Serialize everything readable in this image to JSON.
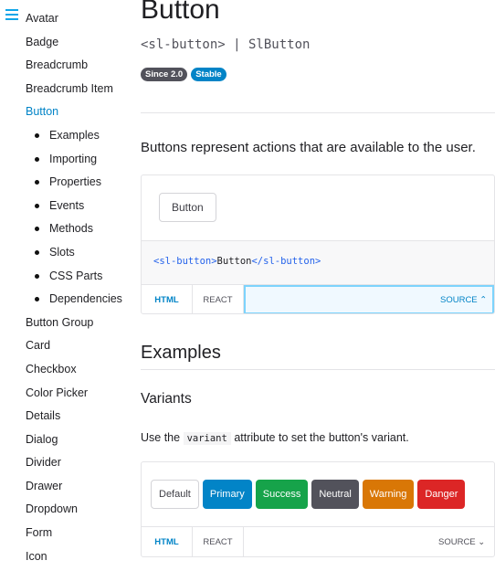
{
  "sidebar": {
    "items": [
      {
        "label": "Avatar"
      },
      {
        "label": "Badge"
      },
      {
        "label": "Breadcrumb"
      },
      {
        "label": "Breadcrumb Item"
      },
      {
        "label": "Button",
        "active": true
      },
      {
        "label": "Examples",
        "sub": true
      },
      {
        "label": "Importing",
        "sub": true
      },
      {
        "label": "Properties",
        "sub": true
      },
      {
        "label": "Events",
        "sub": true
      },
      {
        "label": "Methods",
        "sub": true
      },
      {
        "label": "Slots",
        "sub": true
      },
      {
        "label": "CSS Parts",
        "sub": true
      },
      {
        "label": "Dependencies",
        "sub": true
      },
      {
        "label": "Button Group"
      },
      {
        "label": "Card"
      },
      {
        "label": "Checkbox"
      },
      {
        "label": "Color Picker"
      },
      {
        "label": "Details"
      },
      {
        "label": "Dialog"
      },
      {
        "label": "Divider"
      },
      {
        "label": "Drawer"
      },
      {
        "label": "Dropdown"
      },
      {
        "label": "Form"
      },
      {
        "label": "Icon"
      }
    ]
  },
  "page": {
    "title": "Button",
    "tag": "<sl-button> | SlButton",
    "badges": [
      {
        "label": "Since 2.0",
        "color": "#52525b"
      },
      {
        "label": "Stable",
        "color": "#0284c7"
      }
    ],
    "description": "Buttons represent actions that are available to the user.",
    "demo": {
      "button": "Button",
      "code_open": "<sl-button>",
      "code_text": "Button",
      "code_close": "</sl-button>",
      "tabs": {
        "html": "HTML",
        "react": "REACT",
        "source": "SOURCE ⌃"
      }
    },
    "examples_heading": "Examples",
    "variants_heading": "Variants",
    "variants_text_before": "Use the",
    "variants_code": "variant",
    "variants_text_after": "attribute to set the button's variant.",
    "variants": [
      {
        "label": "Default",
        "color": "#ffffff"
      },
      {
        "label": "Primary",
        "color": "#0284c7"
      },
      {
        "label": "Success",
        "color": "#16a34a"
      },
      {
        "label": "Neutral",
        "color": "#52525b"
      },
      {
        "label": "Warning",
        "color": "#d97706"
      },
      {
        "label": "Danger",
        "color": "#dc2626"
      }
    ],
    "variants_tabs": {
      "html": "HTML",
      "react": "REACT",
      "source": "SOURCE ⌄"
    }
  }
}
